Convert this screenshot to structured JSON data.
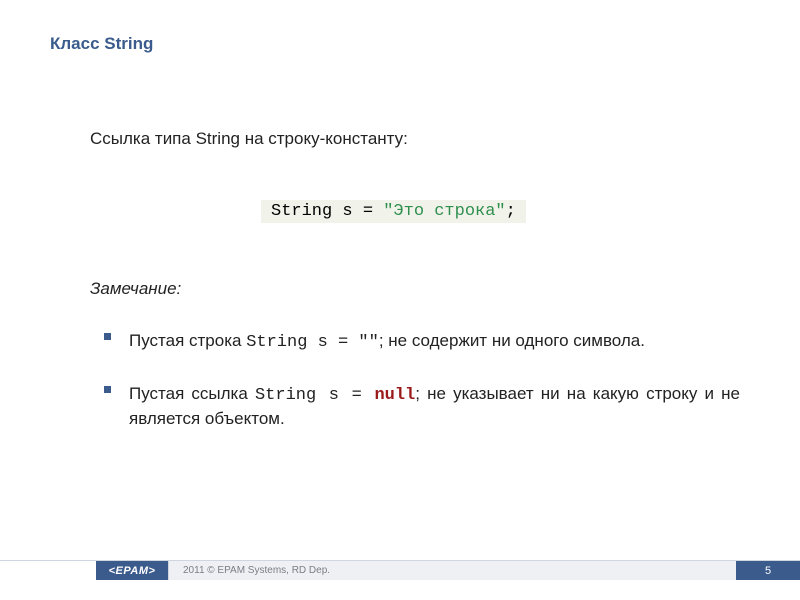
{
  "title": "Класс String",
  "intro": "Ссылка типа String на строку-константу:",
  "code": {
    "lhs": "String s = ",
    "literal": "\"Это строка\"",
    "semi": ";"
  },
  "note_label": "Замечание:",
  "bullets": [
    {
      "pre": "Пустая строка ",
      "code": "String  s = \"\"",
      "post": ";   не содержит ни одного символа."
    },
    {
      "pre": "Пустая ссылка ",
      "code": "String  s = ",
      "kw": "null",
      "post": "; не указывает ни на какую строку и не является объектом."
    }
  ],
  "footer": {
    "logo": "<EPAM>",
    "copyright": "2011 © EPAM Systems, RD Dep.",
    "page": "5"
  }
}
